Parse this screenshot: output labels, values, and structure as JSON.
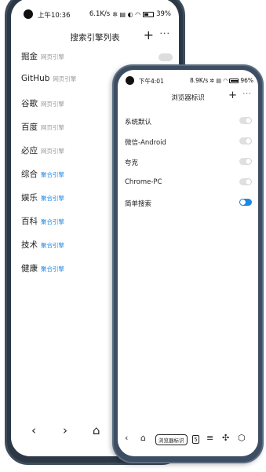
{
  "back_phone": {
    "status": {
      "time": "上午10:36",
      "speed": "6.1K/s",
      "battery": "39%"
    },
    "title": "搜索引擎列表",
    "engines": [
      {
        "name": "掘金",
        "tag": "网页引擎",
        "tag_style": "gray"
      },
      {
        "name": "GitHub",
        "tag": "网页引擎",
        "tag_style": "gray"
      },
      {
        "name": "谷歌",
        "tag": "网页引擎",
        "tag_style": "gray"
      },
      {
        "name": "百度",
        "tag": "网页引擎",
        "tag_style": "gray"
      },
      {
        "name": "必应",
        "tag": "网页引擎",
        "tag_style": "gray"
      },
      {
        "name": "综合",
        "tag": "聚合引擎",
        "tag_style": "blue"
      },
      {
        "name": "娱乐",
        "tag": "聚合引擎",
        "tag_style": "blue"
      },
      {
        "name": "百科",
        "tag": "聚合引擎",
        "tag_style": "blue"
      },
      {
        "name": "技术",
        "tag": "聚合引擎",
        "tag_style": "blue"
      },
      {
        "name": "健康",
        "tag": "聚合引擎",
        "tag_style": "blue"
      }
    ]
  },
  "front_phone": {
    "status": {
      "time": "下午4:01",
      "speed": "8.9K/s",
      "battery": "96%"
    },
    "title": "浏览器标识",
    "options": [
      {
        "label": "系统默认",
        "enabled": false
      },
      {
        "label": "微信-Android",
        "enabled": false
      },
      {
        "label": "夸克",
        "enabled": false
      },
      {
        "label": "Chrome-PC",
        "enabled": false
      },
      {
        "label": "简单搜索",
        "enabled": true
      }
    ],
    "nav": {
      "ua_button": "浏览器标识",
      "tab_count": "5"
    }
  },
  "colors": {
    "accent": "#1e88e5",
    "frame": "#3d4e62"
  }
}
